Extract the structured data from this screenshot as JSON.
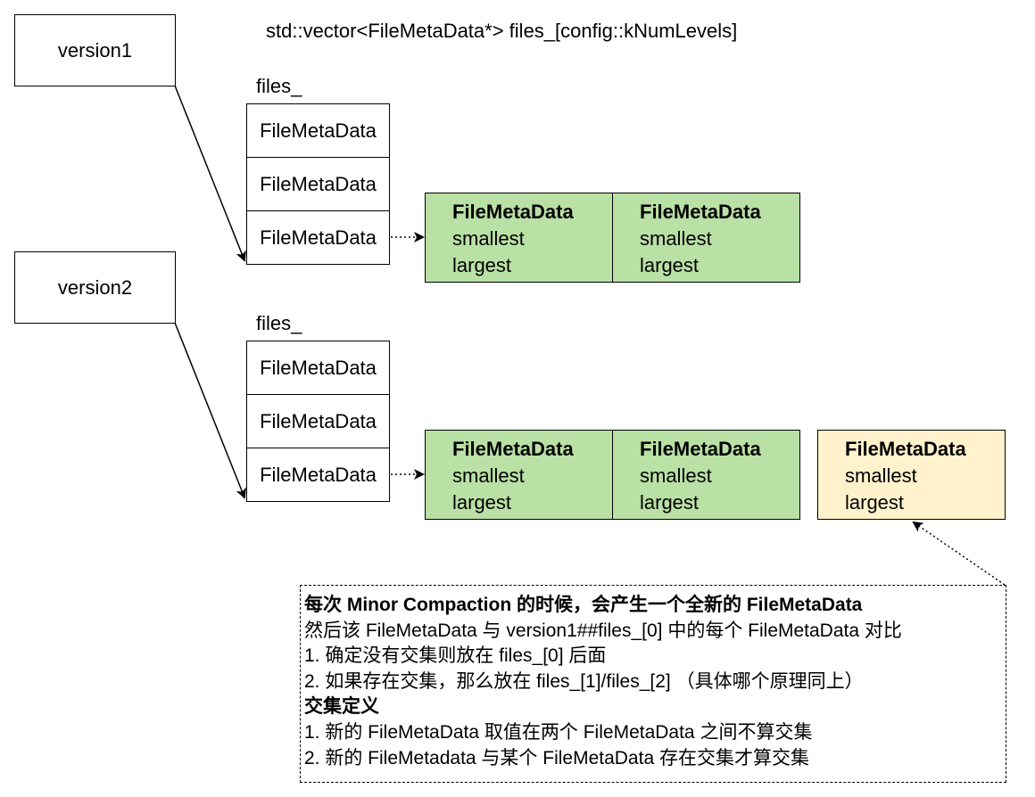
{
  "header": {
    "declaration": "std::vector<FileMetaData*> files_[config::kNumLevels]"
  },
  "versions": [
    {
      "name": "version1",
      "array_label": "files_",
      "cells": [
        "FileMetaData",
        "FileMetaData",
        "FileMetaData"
      ],
      "metas": [
        {
          "title": "FileMetaData",
          "smallest": "smallest",
          "largest": "largest"
        },
        {
          "title": "FileMetaData",
          "smallest": "smallest",
          "largest": "largest"
        }
      ]
    },
    {
      "name": "version2",
      "array_label": "files_",
      "cells": [
        "FileMetaData",
        "FileMetaData",
        "FileMetaData"
      ],
      "metas": [
        {
          "title": "FileMetaData",
          "smallest": "smallest",
          "largest": "largest"
        },
        {
          "title": "FileMetaData",
          "smallest": "smallest",
          "largest": "largest"
        }
      ],
      "new_meta": {
        "title": "FileMetaData",
        "smallest": "smallest",
        "largest": "largest"
      }
    }
  ],
  "note": {
    "title": "每次 Minor Compaction 的时候，会产生一个全新的 FileMetaData",
    "line1": "然后该 FileMetaData 与 version1##files_[0] 中的每个 FileMetaData 对比",
    "line2": "1. 确定没有交集则放在 files_[0] 后面",
    "line3": "2. 如果存在交集，那么放在 files_[1]/files_[2] （具体哪个原理同上）",
    "subtitle": "交集定义",
    "line4": "1. 新的 FileMetaData 取值在两个 FileMetaData 之间不算交集",
    "line5": "2. 新的 FileMetadata 与某个 FileMetaData 存在交集才算交集"
  },
  "colors": {
    "green_fill": "#b9e0a5",
    "yellow_fill": "#fff2cc",
    "stroke": "#000000"
  }
}
